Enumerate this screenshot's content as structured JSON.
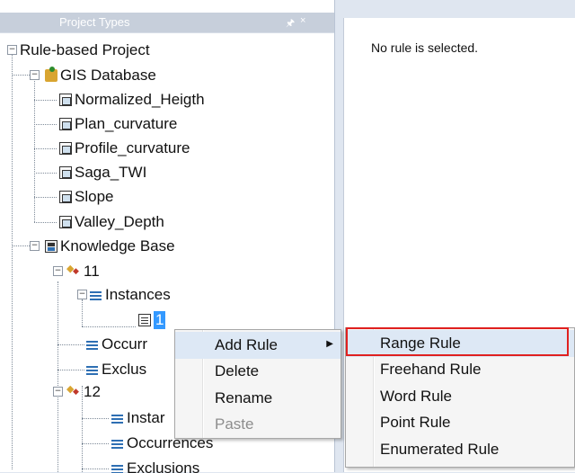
{
  "panel": {
    "title": "Project Types",
    "pin_icon": "pin-icon",
    "close_icon": "close-icon"
  },
  "tree": {
    "root": "Rule-based Project",
    "gis": {
      "label": "GIS Database",
      "layers": [
        "Normalized_Heigth",
        "Plan_curvature",
        "Profile_curvature",
        "Saga_TWI",
        "Slope",
        "Valley_Depth"
      ]
    },
    "kb": {
      "label": "Knowledge Base"
    },
    "rule11": {
      "label": "11",
      "instances": "Instances",
      "instance_item": "1",
      "occurrences": "Occurr",
      "exclusions": "Exclus"
    },
    "rule12": {
      "label": "12",
      "instances": "Instar",
      "occurrences": "Occurrences",
      "exclusions": "Exclusions"
    }
  },
  "right_pane": {
    "message": "No rule is selected."
  },
  "context_menu": {
    "items": [
      "Add Rule",
      "Delete",
      "Rename",
      "Paste"
    ],
    "submenu_arrow": "▶",
    "submenu": [
      "Range Rule",
      "Freehand Rule",
      "Word Rule",
      "Point Rule",
      "Enumerated Rule"
    ]
  },
  "colors": {
    "selection": "#3399ff",
    "highlight_box": "#e0201f",
    "menu_hover": "#dde8f5"
  }
}
